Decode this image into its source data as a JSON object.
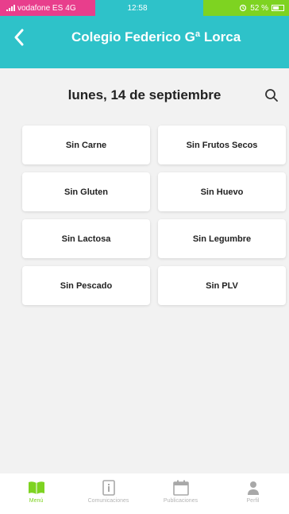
{
  "status_bar": {
    "carrier": "vodafone ES",
    "network": "4G",
    "time": "12:58",
    "battery": "52 %",
    "colors": {
      "carrier_bg": "#e83e8c",
      "battery_bg": "#7ed321"
    }
  },
  "header": {
    "title": "Colegio Federico Gª Lorca",
    "back_icon": "chevron-left-icon",
    "color": "#2ec2c9"
  },
  "date": "lunes, 14 de septiembre",
  "search_icon": "search-icon",
  "options": [
    {
      "label": "Sin Carne"
    },
    {
      "label": "Sin Frutos Secos"
    },
    {
      "label": "Sin Gluten"
    },
    {
      "label": "Sin Huevo"
    },
    {
      "label": "Sin Lactosa"
    },
    {
      "label": "Sin Legumbre"
    },
    {
      "label": "Sin Pescado"
    },
    {
      "label": "Sin PLV"
    }
  ],
  "tabbar": {
    "active_color": "#7ed321",
    "items": [
      {
        "label": "Menú",
        "icon": "book-icon",
        "active": true
      },
      {
        "label": "Comunicaciones",
        "icon": "document-icon",
        "active": false
      },
      {
        "label": "Publicaciones",
        "icon": "calendar-icon",
        "active": false
      },
      {
        "label": "Perfil",
        "icon": "person-icon",
        "active": false
      }
    ]
  }
}
